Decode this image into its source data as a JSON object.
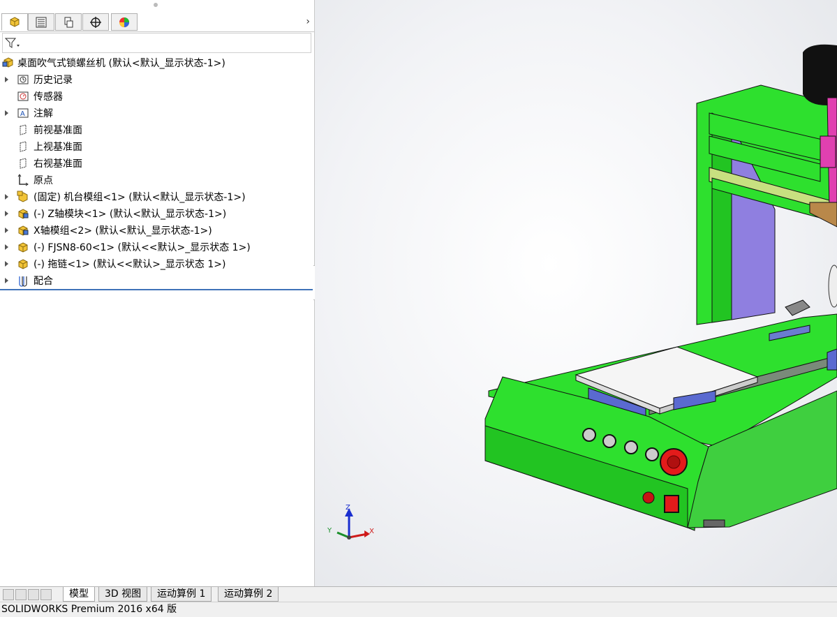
{
  "panel_tabs": [
    {
      "icon": "feature-manager-icon"
    },
    {
      "icon": "property-manager-icon"
    },
    {
      "icon": "configuration-manager-icon"
    },
    {
      "icon": "dimxpert-manager-icon"
    },
    {
      "icon": "display-manager-icon"
    }
  ],
  "tree": {
    "root": "桌面吹气式锁螺丝机  (默认<默认_显示状态-1>)",
    "items": [
      {
        "label": "历史记录",
        "icon": "history-icon",
        "expandable": true
      },
      {
        "label": "传感器",
        "icon": "sensor-icon",
        "expandable": false
      },
      {
        "label": "注解",
        "icon": "annotation-icon",
        "expandable": true
      },
      {
        "label": "前视基准面",
        "icon": "plane-icon",
        "expandable": false
      },
      {
        "label": "上视基准面",
        "icon": "plane-icon",
        "expandable": false
      },
      {
        "label": "右视基准面",
        "icon": "plane-icon",
        "expandable": false
      },
      {
        "label": "原点",
        "icon": "origin-icon",
        "expandable": false
      },
      {
        "label": "(固定) 机台模组<1> (默认<默认_显示状态-1>)",
        "icon": "subassembly-fixed-icon",
        "expandable": true
      },
      {
        "label": "(-) Z轴模块<1> (默认<默认_显示状态-1>)",
        "icon": "subassembly-icon",
        "expandable": true
      },
      {
        "label": "X轴模组<2> (默认<默认_显示状态-1>)",
        "icon": "subassembly-icon",
        "expandable": true
      },
      {
        "label": "(-) FJSN8-60<1> (默认<<默认>_显示状态 1>)",
        "icon": "part-icon",
        "expandable": true
      },
      {
        "label": "(-) 拖链<1> (默认<<默认>_显示状态 1>)",
        "icon": "part-icon",
        "expandable": true
      },
      {
        "label": "配合",
        "icon": "mates-icon",
        "expandable": true
      }
    ]
  },
  "triad": {
    "x": "X",
    "y": "Y",
    "z": "Z"
  },
  "bottom_tabs": [
    "模型",
    "3D 视图",
    "运动算例 1",
    "运动算例 2"
  ],
  "status_text": "SOLIDWORKS Premium 2016 x64 版",
  "colors": {
    "machine_green": "#2ee02e",
    "accent_purple": "#8f7fe0",
    "emergency_red": "#e31b1b",
    "pink_head": "#e040b0"
  }
}
